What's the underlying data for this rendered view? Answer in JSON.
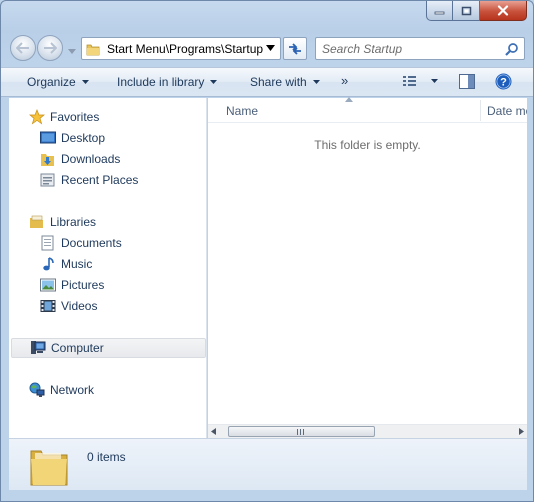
{
  "address": {
    "path": "Start Menu\\Programs\\Startup"
  },
  "search": {
    "placeholder": "Search Startup"
  },
  "toolbar": {
    "organize": "Organize",
    "include_in_library": "Include in library",
    "share_with": "Share with",
    "more": "»"
  },
  "nav": {
    "favorites": {
      "label": "Favorites",
      "items": [
        "Desktop",
        "Downloads",
        "Recent Places"
      ]
    },
    "libraries": {
      "label": "Libraries",
      "items": [
        "Documents",
        "Music",
        "Pictures",
        "Videos"
      ]
    },
    "computer": "Computer",
    "network": "Network"
  },
  "filepane": {
    "columns": [
      "Name",
      "Date mo"
    ],
    "empty_message": "This folder is empty."
  },
  "details": {
    "item_count": "0 items"
  },
  "icons": [
    "minimize-icon",
    "maximize-icon",
    "close-icon",
    "back-arrow-icon",
    "forward-arrow-icon",
    "folder-icon",
    "refresh-icon",
    "search-icon",
    "views-icon",
    "preview-pane-icon",
    "help-icon",
    "star-icon",
    "desktop-icon",
    "downloads-icon",
    "recent-places-icon",
    "libraries-icon",
    "documents-icon",
    "music-icon",
    "pictures-icon",
    "videos-icon",
    "computer-icon",
    "network-icon"
  ],
  "colors": {
    "accent": "#1e395b",
    "close_button": "#c7513b",
    "help": "#1d5ebc"
  }
}
